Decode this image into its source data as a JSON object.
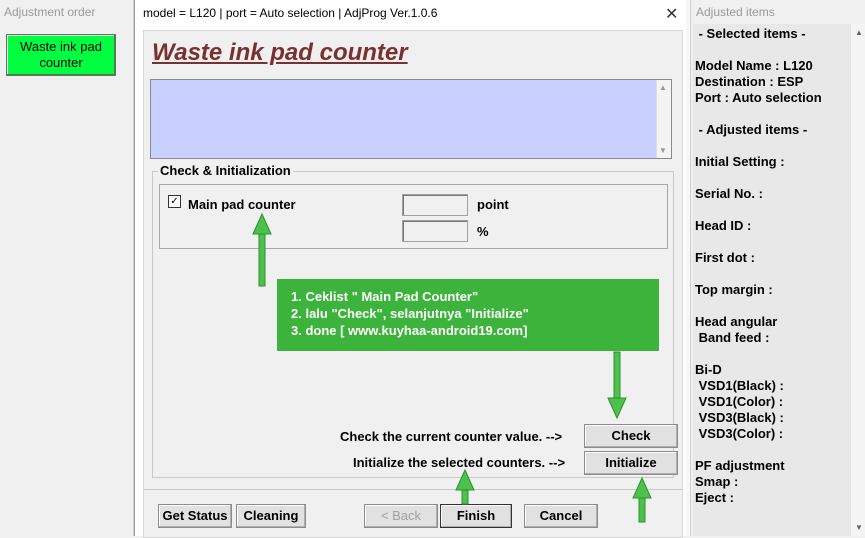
{
  "left_window": {
    "title": "Adjustment order",
    "waste_button_label": "Waste ink pad\ncounter",
    "waste_button_color": "#00ff40"
  },
  "main_window": {
    "title": "model = L120 | port = Auto selection | AdjProg Ver.1.0.6",
    "close_icon": "close-icon",
    "heading": "Waste ink pad counter",
    "heading_color": "#7a3030",
    "textarea_color": "#c8d0ff",
    "group_label": "Check & Initialization",
    "pad_checkbox_checked": true,
    "pad_checkbox_mark": "✓",
    "pad_label": "Main pad counter",
    "point_unit": "point",
    "percent_unit": "%",
    "point_value": "",
    "percent_value": "",
    "instructions": [
      "1. Ceklist \" Main Pad Counter\"",
      "2. lalu \"Check\", selanjutnya \"Initialize\"",
      "3. done [ www.kuyhaa-android19.com]"
    ],
    "instructions_bg": "#3cb43c",
    "arrow_color": "#4cc24c",
    "check_text": "Check the current counter value. -->",
    "check_button": "Check",
    "init_text": "Initialize the selected counters. -->",
    "init_button": "Initialize",
    "buttons": {
      "get_status": "Get Status",
      "cleaning": "Cleaning",
      "back": "< Back",
      "finish": "Finish",
      "cancel": "Cancel"
    }
  },
  "right_window": {
    "title": "Adjusted items",
    "lines": [
      " - Selected items -",
      "",
      "Model Name : L120",
      "Destination : ESP",
      "Port : Auto selection",
      "",
      " - Adjusted items -",
      "",
      "Initial Setting :",
      "",
      "Serial No. :",
      "",
      "Head ID :",
      "",
      "First dot :",
      "",
      "Top margin :",
      "",
      "Head angular",
      " Band feed :",
      "",
      "Bi-D",
      " VSD1(Black) :",
      " VSD1(Color) :",
      " VSD3(Black) :",
      " VSD3(Color) :",
      "",
      "PF adjustment",
      "Smap :",
      "Eject :"
    ]
  }
}
